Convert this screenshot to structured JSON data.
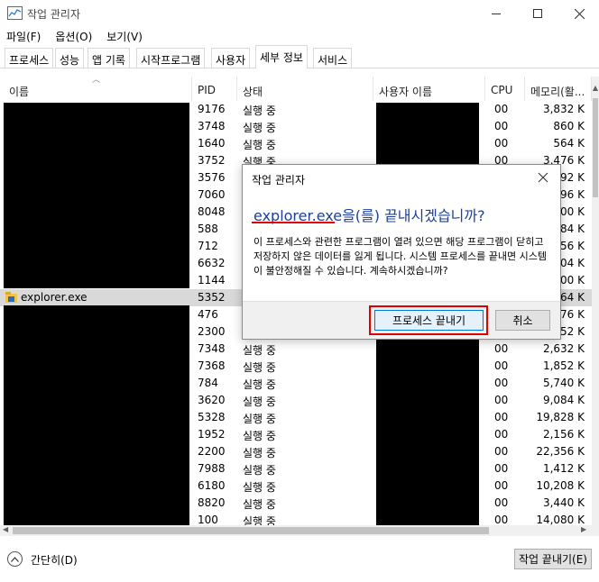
{
  "window": {
    "title": "작업 관리자"
  },
  "menu": [
    "파일(F)",
    "옵션(O)",
    "보기(V)"
  ],
  "tabs": [
    "프로세스",
    "성능",
    "앱 기록",
    "시작프로그램",
    "사용자",
    "세부 정보",
    "서비스"
  ],
  "active_tab": "세부 정보",
  "columns": [
    "이름",
    "PID",
    "상태",
    "사용자 이름",
    "CPU",
    "메모리(활..."
  ],
  "rows": [
    {
      "name": "",
      "pid": "9176",
      "status": "실행 중",
      "cpu": "00",
      "memory": "3,832 K"
    },
    {
      "name": "",
      "pid": "3748",
      "status": "실행 중",
      "cpu": "00",
      "memory": "860 K"
    },
    {
      "name": "",
      "pid": "1640",
      "status": "실행 중",
      "cpu": "00",
      "memory": "564 K"
    },
    {
      "name": "",
      "pid": "3752",
      "status": "실행 중",
      "cpu": "00",
      "memory": "3,476 K"
    },
    {
      "name": "",
      "pid": "3576",
      "status": "",
      "cpu": "",
      "memory": "92 K"
    },
    {
      "name": "",
      "pid": "7060",
      "status": "",
      "cpu": "",
      "memory": "96 K"
    },
    {
      "name": "",
      "pid": "8048",
      "status": "",
      "cpu": "",
      "memory": "00 K"
    },
    {
      "name": "",
      "pid": "588",
      "status": "",
      "cpu": "",
      "memory": "84 K"
    },
    {
      "name": "",
      "pid": "712",
      "status": "",
      "cpu": "",
      "memory": "56 K"
    },
    {
      "name": "",
      "pid": "6632",
      "status": "",
      "cpu": "",
      "memory": "04 K"
    },
    {
      "name": "",
      "pid": "1144",
      "status": "",
      "cpu": "",
      "memory": "00 K"
    },
    {
      "name": "explorer.exe",
      "pid": "5352",
      "status": "",
      "cpu": "",
      "memory": "64 K"
    },
    {
      "name": "",
      "pid": "476",
      "status": "",
      "cpu": "",
      "memory": "76 K"
    },
    {
      "name": "",
      "pid": "2300",
      "status": "",
      "cpu": "",
      "memory": "52 K"
    },
    {
      "name": "",
      "pid": "7348",
      "status": "실행 중",
      "cpu": "00",
      "memory": "2,632 K"
    },
    {
      "name": "",
      "pid": "7368",
      "status": "실행 중",
      "cpu": "00",
      "memory": "1,852 K"
    },
    {
      "name": "",
      "pid": "784",
      "status": "실행 중",
      "cpu": "00",
      "memory": "5,740 K"
    },
    {
      "name": "",
      "pid": "3620",
      "status": "실행 중",
      "cpu": "00",
      "memory": "9,084 K"
    },
    {
      "name": "",
      "pid": "5328",
      "status": "실행 중",
      "cpu": "00",
      "memory": "19,828 K"
    },
    {
      "name": "",
      "pid": "1952",
      "status": "실행 중",
      "cpu": "00",
      "memory": "2,156 K"
    },
    {
      "name": "",
      "pid": "2200",
      "status": "실행 중",
      "cpu": "00",
      "memory": "22,356 K"
    },
    {
      "name": "",
      "pid": "7988",
      "status": "실행 중",
      "cpu": "00",
      "memory": "1,412 K"
    },
    {
      "name": "",
      "pid": "6180",
      "status": "실행 중",
      "cpu": "00",
      "memory": "10,208 K"
    },
    {
      "name": "",
      "pid": "8820",
      "status": "실행 중",
      "cpu": "00",
      "memory": "3,440 K"
    },
    {
      "name": "",
      "pid": "100",
      "status": "실행 중",
      "cpu": "00",
      "memory": "14,080 K"
    }
  ],
  "selected_row": "explorer.exe",
  "footer": {
    "collapse_label": "간단히(D)",
    "end_task_label": "작업 끝내기(E)"
  },
  "dialog": {
    "title": "작업 관리자",
    "heading": "explorer.exe을(를) 끝내시겠습니까?",
    "body": "이 프로세스와 관련한 프로그램이 열려 있으면 해당 프로그램이 닫히고 저장하지 않은 데이터를 잃게 됩니다. 시스템 프로세스를 끝내면 시스템이 불안정해질 수 있습니다. 계속하시겠습니까?",
    "confirm_label": "프로세스 끝내기",
    "cancel_label": "취소"
  },
  "colors": {
    "selection": "#d9d9d9",
    "heading": "#1e3f9b",
    "highlight_red": "#e00000",
    "primary_border": "#0078d7"
  },
  "icons": {
    "app": "task-manager-icon",
    "process": "folder-icon"
  }
}
